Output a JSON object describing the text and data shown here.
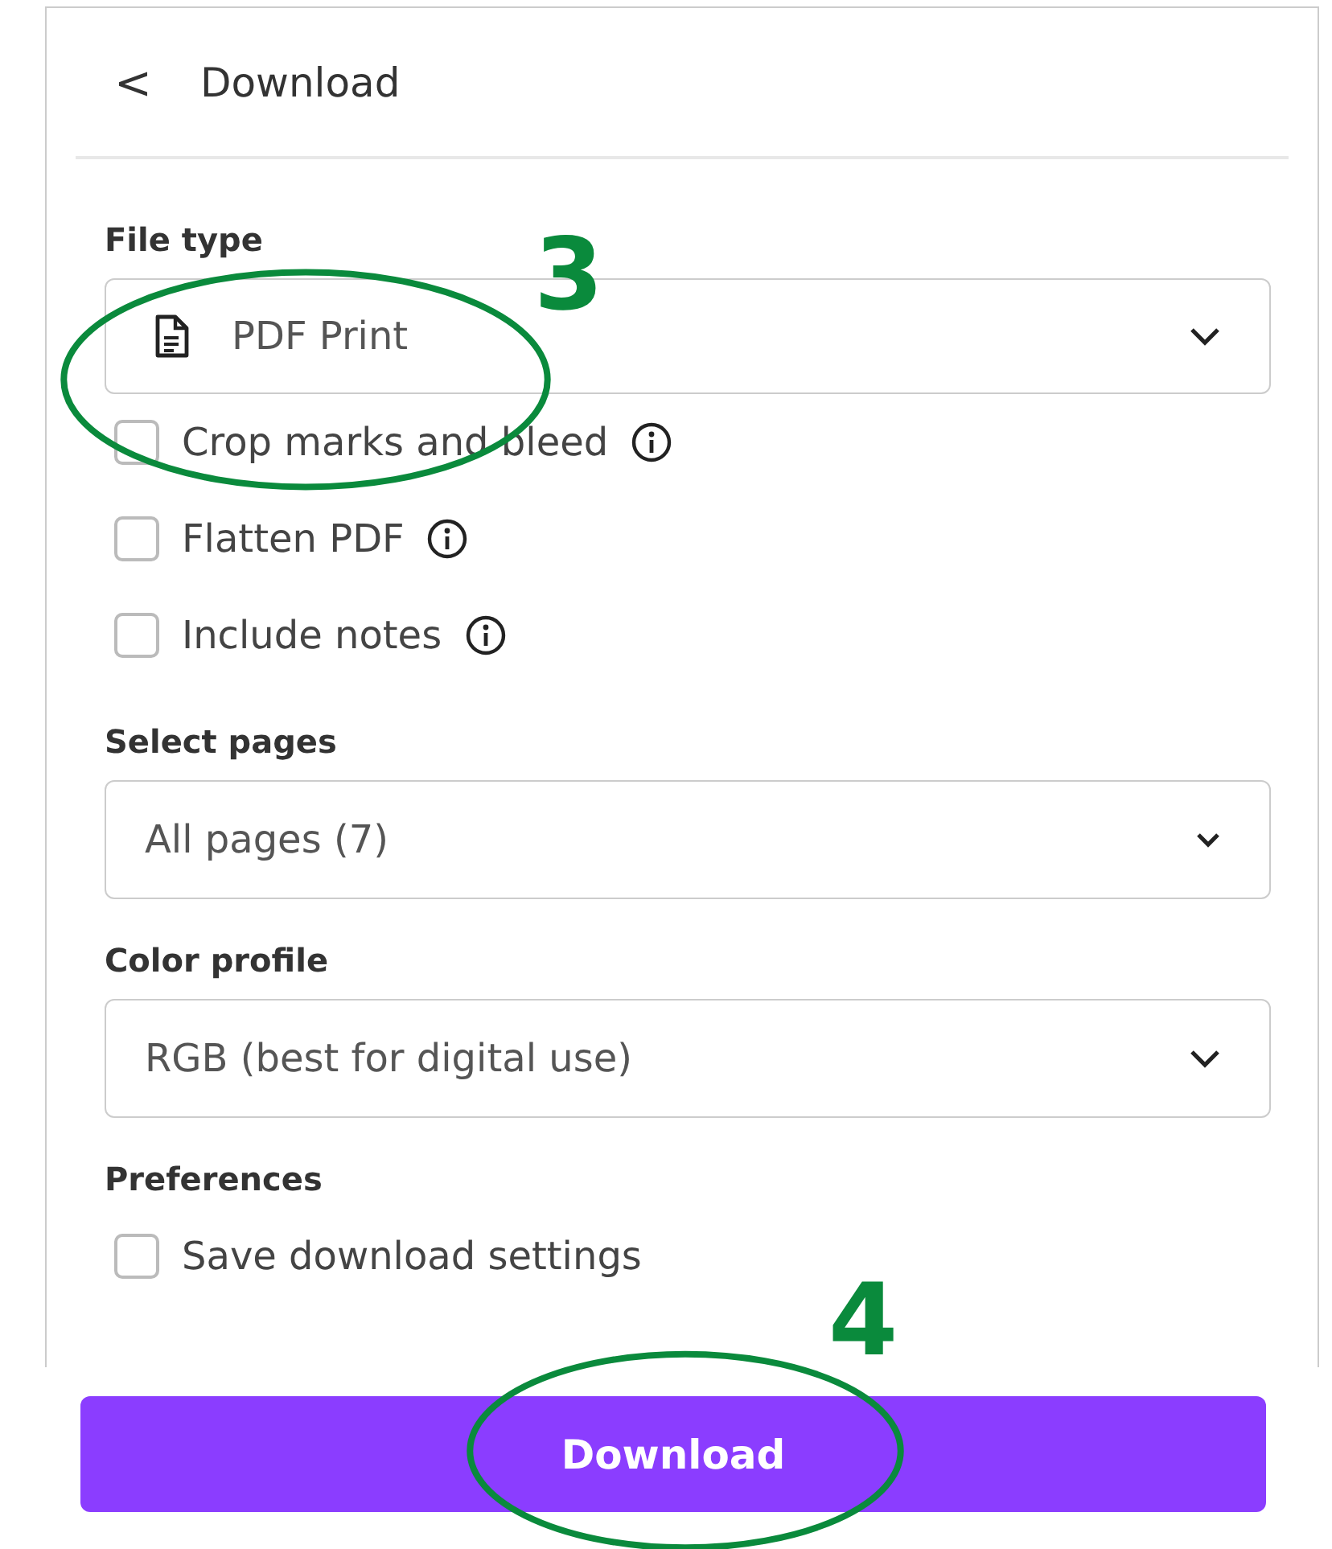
{
  "header": {
    "back_icon": "<",
    "title": "Download"
  },
  "file_type": {
    "label": "File type",
    "value": "PDF Print"
  },
  "options": [
    {
      "label": "Crop marks and bleed",
      "checked": false,
      "info": true
    },
    {
      "label": "Flatten PDF",
      "checked": false,
      "info": true
    },
    {
      "label": "Include notes",
      "checked": false,
      "info": true
    }
  ],
  "select_pages": {
    "label": "Select pages",
    "value": "All pages (7)"
  },
  "color_profile": {
    "label": "Color profile",
    "value": "RGB (best for digital use)"
  },
  "preferences": {
    "label": "Preferences",
    "options": [
      {
        "label": "Save download settings",
        "checked": false
      }
    ]
  },
  "download_button": "Download",
  "annotations": [
    {
      "label": "3"
    },
    {
      "label": "4"
    }
  ]
}
